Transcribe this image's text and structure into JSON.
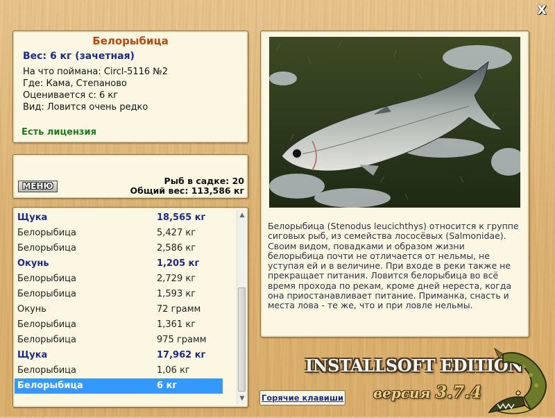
{
  "window": {
    "close_glyph": "X"
  },
  "info": {
    "title": "Белорыбица",
    "weight_line": "Вес: 6 кг (зачетная)",
    "lines": [
      {
        "label": "На что поймана: ",
        "value": "Circl-5116 №2"
      },
      {
        "label": "Где: ",
        "value": "Кама, Степаново"
      },
      {
        "label": "Оценивается с: ",
        "value": "6 кг"
      },
      {
        "label": "Вид: ",
        "value": "Ловится очень редко"
      }
    ],
    "license": "Есть лицензия"
  },
  "menu": {
    "button_label": "МЕНЮ",
    "fish_in_net": "Рыб в садке: 20",
    "total_weight": "Общий вес: 113,586 кг"
  },
  "catch_list": [
    {
      "name": "Щука",
      "weight": "18,565 кг",
      "bold": true
    },
    {
      "name": "Белорыбица",
      "weight": "5,427 кг"
    },
    {
      "name": "Белорыбица",
      "weight": "2,586 кг"
    },
    {
      "name": "Окунь",
      "weight": "1,205 кг",
      "bold": true
    },
    {
      "name": "Белорыбица",
      "weight": "2,729 кг"
    },
    {
      "name": "Белорыбица",
      "weight": "1,593 кг"
    },
    {
      "name": "Окунь",
      "weight": "72 грамм"
    },
    {
      "name": "Белорыбица",
      "weight": "1,361 кг"
    },
    {
      "name": "Белорыбица",
      "weight": "975 грамм"
    },
    {
      "name": "Щука",
      "weight": "17,962 кг",
      "bold": true
    },
    {
      "name": "Белорыбица",
      "weight": "1,06 кг"
    },
    {
      "name": "Белорыбица",
      "weight": "6 кг",
      "selected": true
    }
  ],
  "description": "Белорыбица (Stenodus leucichthys) относится к группе сиговых рыб, из семейства лососёвых (Salmonidae). Своим видом, повадками и образом жизни белорыбица почти не отличается от нельмы, не уступая ей и в величине. При входе в реки также не прекращает питания. Ловится белорыбица во всё время прохода по рекам, кроме дней нереста, когда она приостанавливает питание. Приманка, снасть и места лова - те же, что и при ловле нельмы.",
  "footer": {
    "hotkeys": "Горячие клавиши",
    "brand": "INSTALLSOFT EDITION",
    "version_prefix": "версия ",
    "version_number": "3.7.4"
  },
  "colors": {
    "title": "#b8480f",
    "bold_text": "#1a2a86",
    "license": "#1d7a1d",
    "selection": "#3399ff",
    "background": "#ddb272"
  },
  "icons": {
    "close": "close-icon",
    "logo": "pike-fish-logo",
    "photo": "fish-photo"
  }
}
